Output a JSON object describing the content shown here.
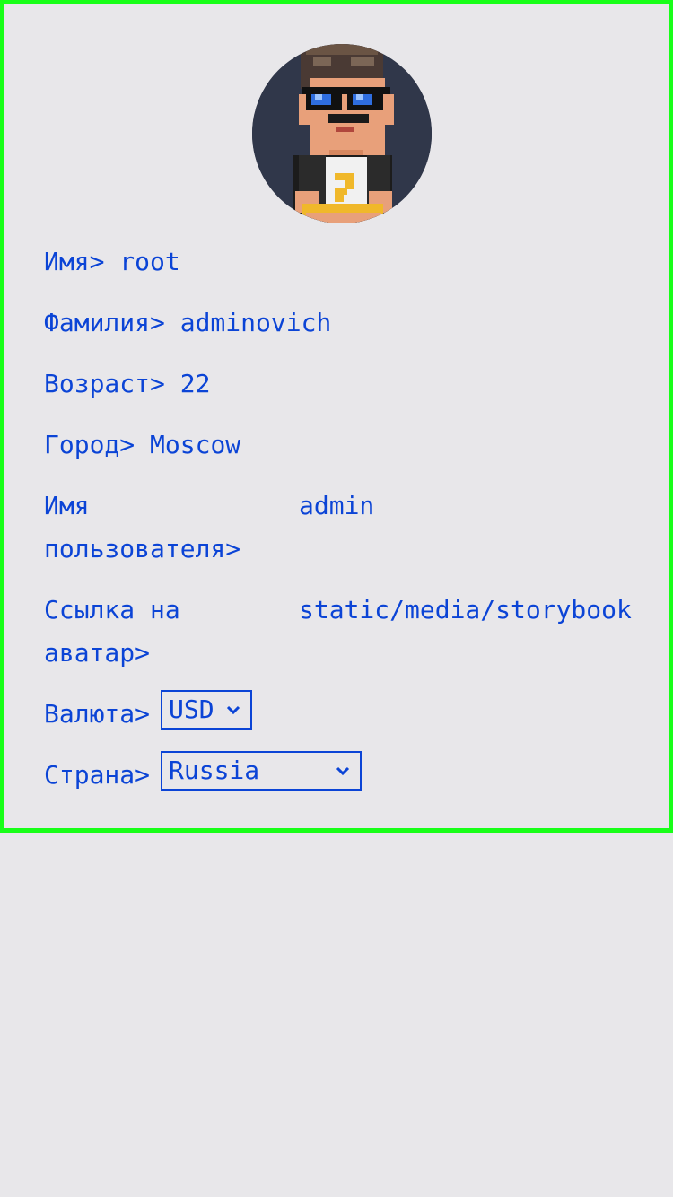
{
  "profile": {
    "first_name": {
      "label": "Имя>",
      "value": "root"
    },
    "last_name": {
      "label": "Фамилия>",
      "value": "adminovich"
    },
    "age": {
      "label": "Возраст>",
      "value": "22"
    },
    "city": {
      "label": "Город>",
      "value": "Moscow"
    },
    "username": {
      "label": "Имя\nпользователя>",
      "value": "admin"
    },
    "avatar_link": {
      "label": "Ссылка на\nаватар>",
      "value": "static/media/storybook"
    },
    "currency": {
      "label": "Валюта>",
      "selected": "USD"
    },
    "country": {
      "label": "Страна>",
      "selected": "Russia"
    }
  },
  "colors": {
    "accent": "#0b44d6",
    "border": "#18ff18",
    "background": "#e8e7ea",
    "avatar_bg": "#30374a"
  },
  "icons": {
    "avatar": "pixel-art-person-with-sunglasses",
    "select_arrow": "chevron-down-icon"
  }
}
